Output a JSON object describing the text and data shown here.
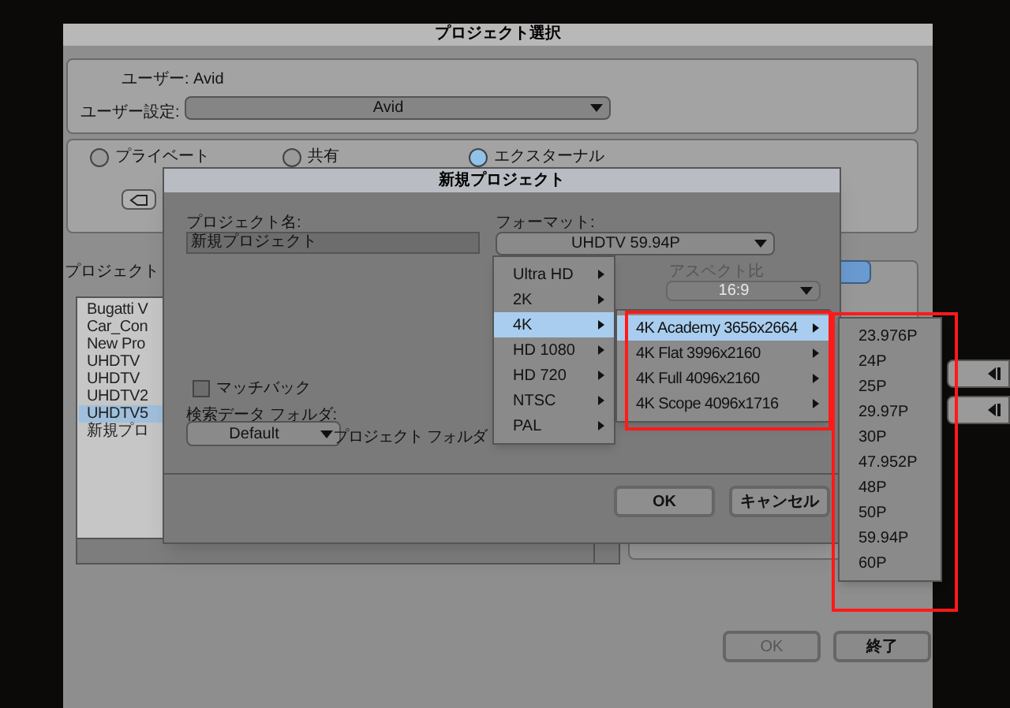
{
  "window": {
    "title": "プロジェクト選択"
  },
  "user": {
    "label": "ユーザー: Avid",
    "settings_label": "ユーザー設定:",
    "settings_value": "Avid"
  },
  "location_options": [
    {
      "label": "プライベート",
      "selected": false
    },
    {
      "label": "共有",
      "selected": false
    },
    {
      "label": "エクスターナル",
      "selected": true
    }
  ],
  "project_list": {
    "label": "プロジェクト",
    "items": [
      {
        "label": "Bugatti V",
        "selected": false
      },
      {
        "label": "Car_Con",
        "selected": false
      },
      {
        "label": "New Pro",
        "selected": false
      },
      {
        "label": "UHDTV",
        "selected": false
      },
      {
        "label": "UHDTV",
        "selected": false
      },
      {
        "label": "UHDTV2",
        "selected": false
      },
      {
        "label": "UHDTV5",
        "selected": true
      },
      {
        "label": "新規プロ",
        "selected": false
      }
    ]
  },
  "buttons": [
    {
      "label": "OK",
      "disabled": true
    },
    {
      "label": "終了",
      "disabled": false
    }
  ],
  "dialog": {
    "title": "新規プロジェクト",
    "name_label": "プロジェクト名:",
    "name_value": "新規プロジェクト",
    "format_label": "フォーマット:",
    "format_value": "UHDTV 59.94P",
    "aspect_label": "アスペクト比",
    "aspect_value": "16:9",
    "matchback": {
      "label": "マッチバック",
      "checked": false
    },
    "search_folder_label": "検索データ フォルダ:",
    "search_folder_value": "Default",
    "project_folder_label": "プロジェクト フォルダ",
    "buttons": [
      {
        "label": "OK"
      },
      {
        "label": "キャンセル"
      }
    ]
  },
  "format_menu": [
    {
      "label": "Ultra HD",
      "selected": false
    },
    {
      "label": "2K",
      "selected": false
    },
    {
      "label": "4K",
      "selected": true
    },
    {
      "label": "HD 1080",
      "selected": false
    },
    {
      "label": "HD 720",
      "selected": false
    },
    {
      "label": "NTSC",
      "selected": false
    },
    {
      "label": "PAL",
      "selected": false
    }
  ],
  "size_menu": [
    {
      "label": "4K Academy 3656x2664",
      "selected": true
    },
    {
      "label": "4K Flat 3996x2160",
      "selected": false
    },
    {
      "label": "4K Full 4096x2160",
      "selected": false
    },
    {
      "label": "4K Scope 4096x1716",
      "selected": false
    }
  ],
  "rate_menu": [
    {
      "label": "23.976P"
    },
    {
      "label": "24P"
    },
    {
      "label": "25P"
    },
    {
      "label": "29.97P"
    },
    {
      "label": "30P"
    },
    {
      "label": "47.952P"
    },
    {
      "label": "48P"
    },
    {
      "label": "50P"
    },
    {
      "label": "59.94P"
    },
    {
      "label": "60P"
    }
  ]
}
